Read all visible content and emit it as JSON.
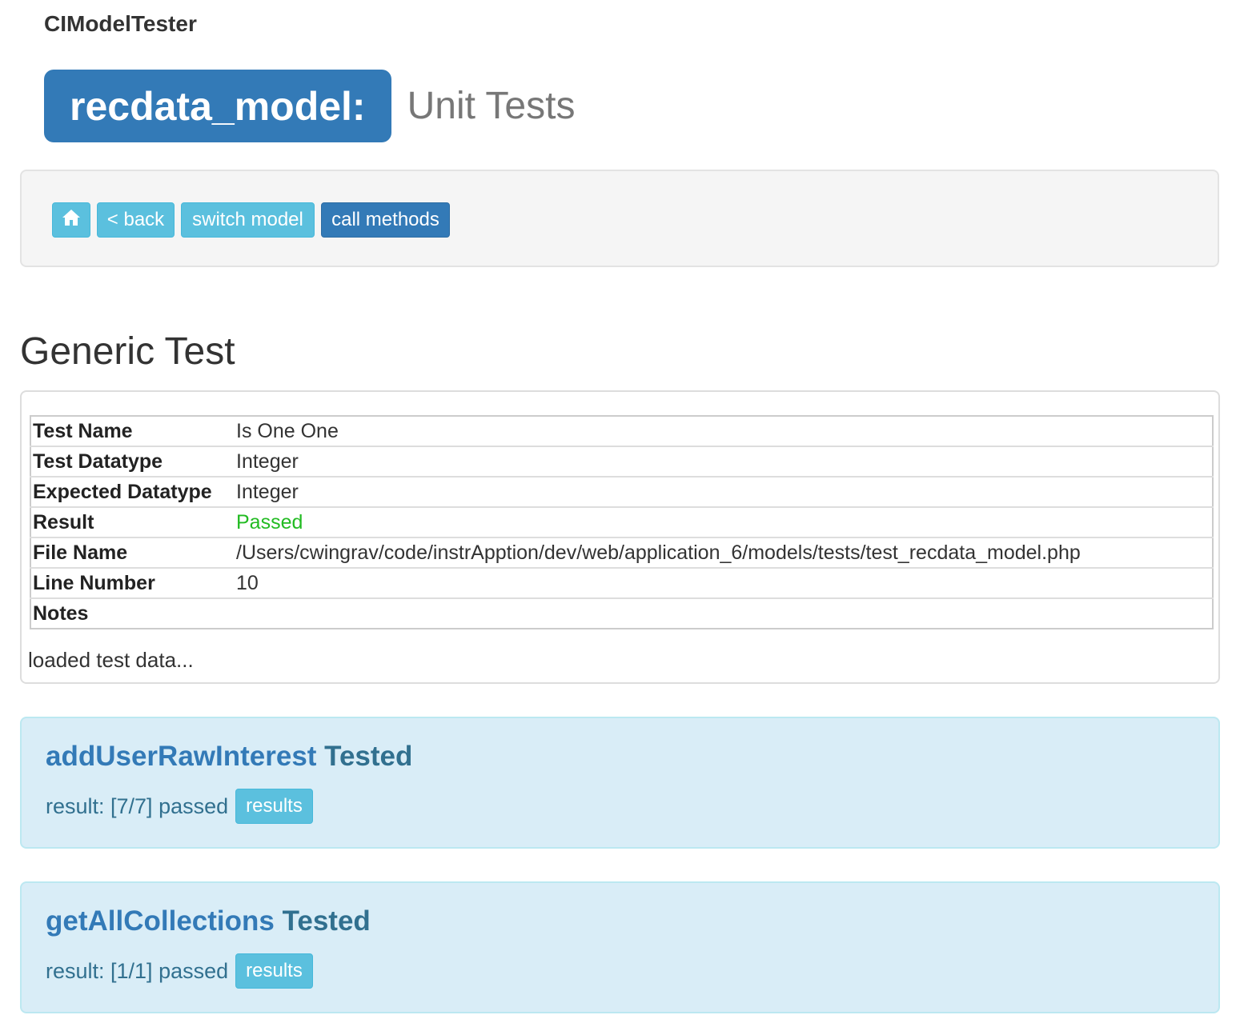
{
  "brand": "CIModelTester",
  "header": {
    "model": "recdata_model:",
    "subtitle": "Unit Tests"
  },
  "toolbar": {
    "home_icon": "home-icon",
    "back_label": "< back",
    "switch_label": "switch model",
    "call_label": "call methods"
  },
  "generic_test": {
    "title": "Generic Test",
    "rows": [
      {
        "label": "Test Name",
        "value": "Is One One"
      },
      {
        "label": "Test Datatype",
        "value": "Integer"
      },
      {
        "label": "Expected Datatype",
        "value": "Integer"
      },
      {
        "label": "Result",
        "value": "Passed"
      },
      {
        "label": "File Name",
        "value": "/Users/cwingrav/code/instrApption/dev/web/application_6/models/tests/test_recdata_model.php"
      },
      {
        "label": "Line Number",
        "value": "10"
      },
      {
        "label": "Notes",
        "value": ""
      }
    ],
    "status": "loaded test data..."
  },
  "method_results": [
    {
      "method": "addUserRawInterest",
      "suffix": " Tested",
      "result": "result: [7/7] passed",
      "button": "results"
    },
    {
      "method": "getAllCollections",
      "suffix": " Tested",
      "result": "result: [1/1] passed",
      "button": "results"
    }
  ],
  "colors": {
    "primary": "#337ab7",
    "info": "#5bc0de",
    "passed": "#22bb22",
    "panel_info_bg": "#d9edf7"
  }
}
